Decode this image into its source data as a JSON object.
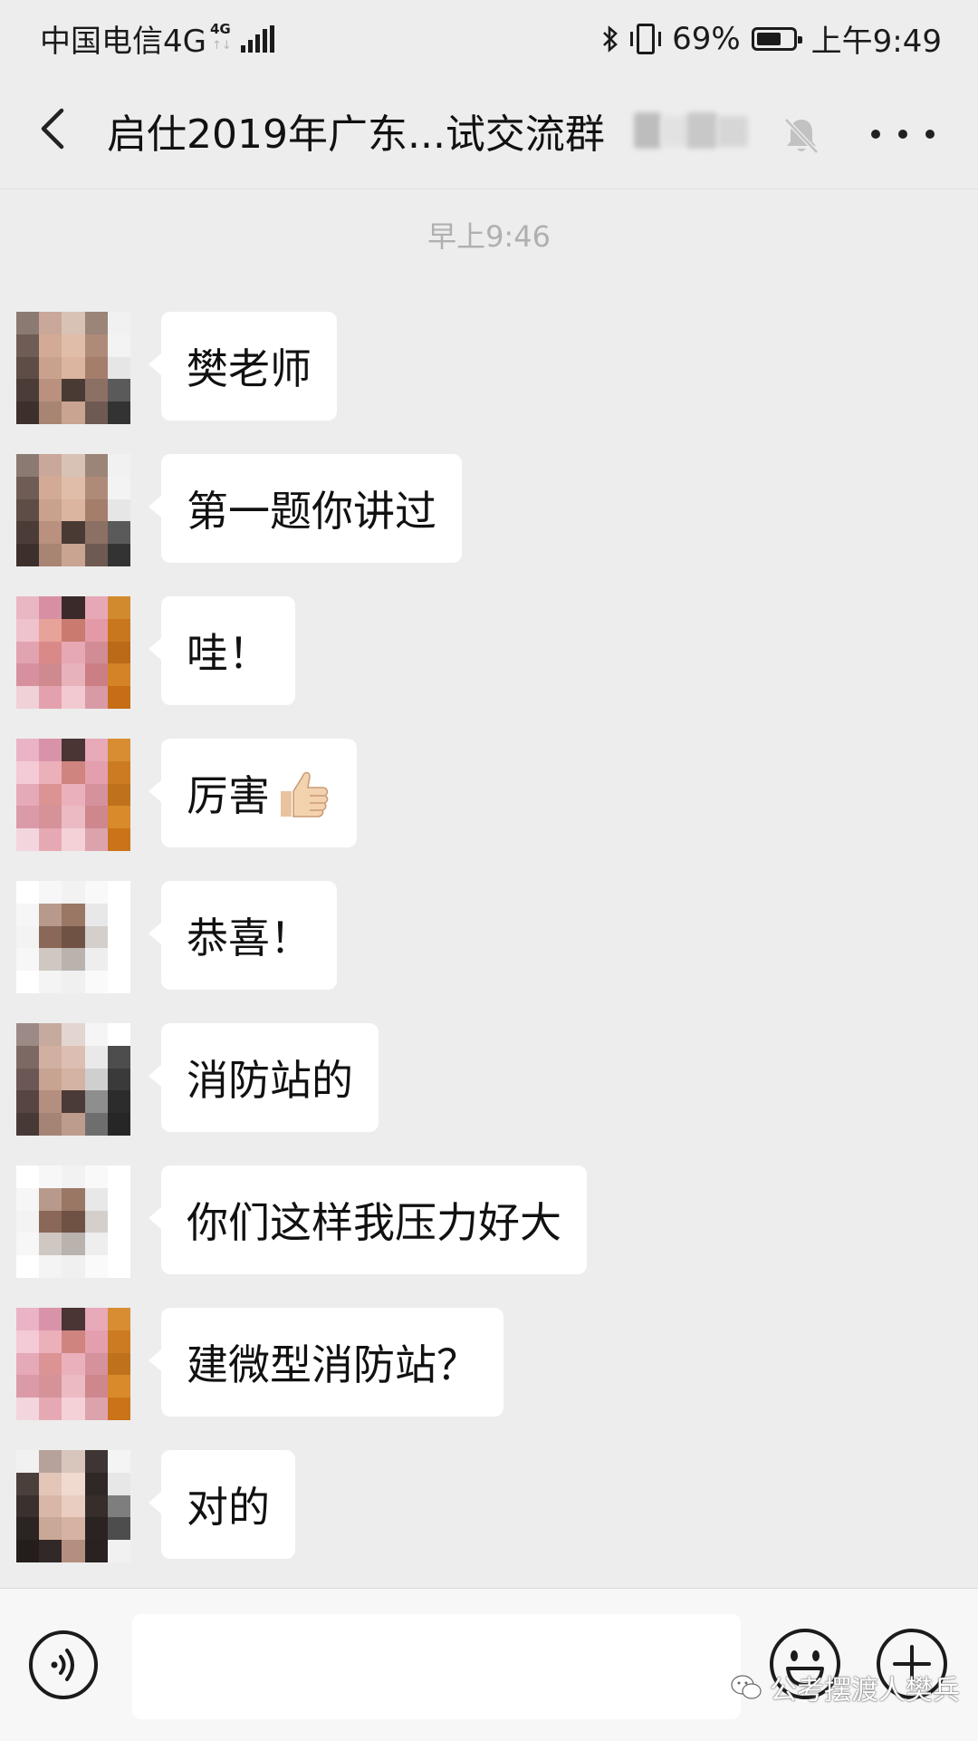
{
  "status_bar": {
    "carrier": "中国电信4G",
    "network_badge_top": "4G",
    "network_badge_arrows": "↑↓",
    "battery_percent": "69%",
    "battery_level": 0.69,
    "time": "上午9:49",
    "icons": [
      "signal-icon",
      "bluetooth-icon",
      "vibrate-icon",
      "battery-icon"
    ]
  },
  "header": {
    "title": "启仕2019年广东...试交流群",
    "icons": [
      "back-icon",
      "mute-bell-icon",
      "more-icon"
    ]
  },
  "timestamp": "早上9:46",
  "messages": [
    {
      "text": "樊老师"
    },
    {
      "text": "第一题你讲过"
    },
    {
      "text": "哇！"
    },
    {
      "text": "厉害",
      "emoji": "thumbs-up-icon"
    },
    {
      "text": "恭喜！"
    },
    {
      "text": "消防站的"
    },
    {
      "text": "你们这样我压力好大"
    },
    {
      "text": "建微型消防站？"
    },
    {
      "text": "对的"
    }
  ],
  "input_bar": {
    "value": "",
    "icons": [
      "voice-icon",
      "emoji-icon",
      "plus-icon"
    ]
  },
  "watermark": {
    "text": "公考摆渡人樊兵",
    "icon": "wechat-icon"
  },
  "colors": {
    "background": "#ededed",
    "bubble": "#ffffff",
    "text": "#111111",
    "timestamp": "#b0b0b0"
  }
}
